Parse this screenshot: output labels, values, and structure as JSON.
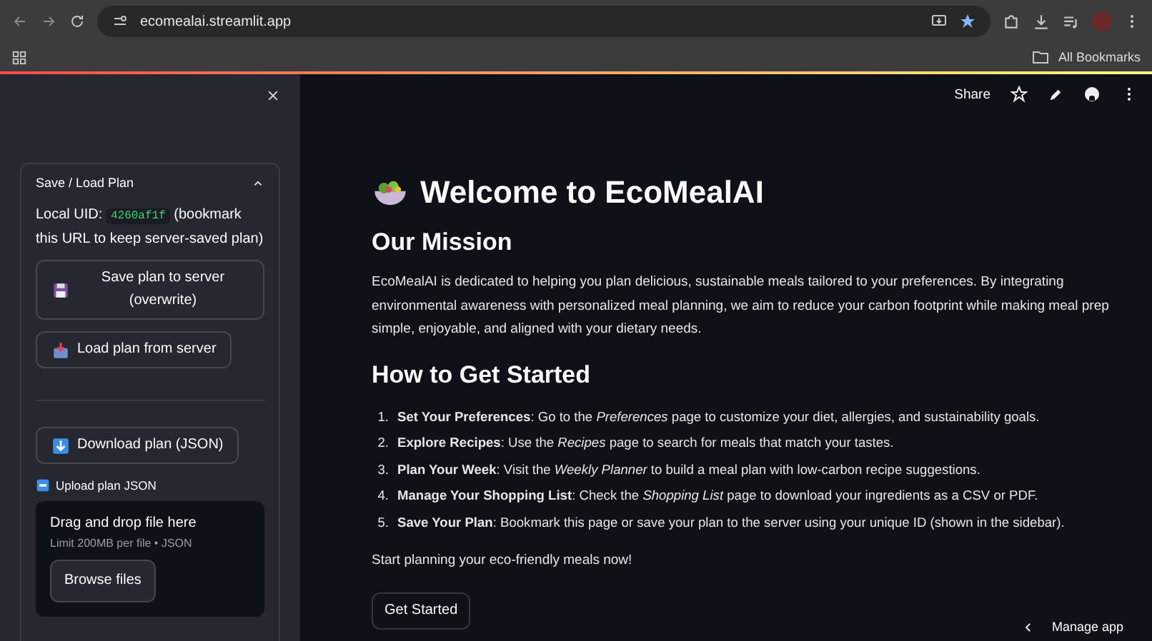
{
  "browser": {
    "url": "ecomealai.streamlit.app",
    "bookmarks_label": "All Bookmarks"
  },
  "sidebar": {
    "panel": {
      "title": "Save / Load Plan",
      "expanded": true,
      "uid_label": "Local UID:",
      "uid": "4260af1f",
      "uid_note": "(bookmark this URL to keep server-saved plan)",
      "buttons": [
        {
          "kind": "save",
          "label": "Save plan to server (overwrite)"
        },
        {
          "kind": "load",
          "label": "Load plan from server"
        }
      ],
      "download_button": {
        "kind": "download",
        "label": "Download plan (JSON)"
      },
      "upload": {
        "label": "Upload plan JSON",
        "drop_text": "Drag and drop file here",
        "limit": "Limit 200MB per file • JSON",
        "browse_button": "Browse files"
      }
    }
  },
  "toolbar": {
    "share": "Share"
  },
  "main": {
    "title": "Welcome to EcoMealAI",
    "mission_heading": "Our Mission",
    "mission_text": "EcoMealAI is dedicated to helping you plan delicious, sustainable meals tailored to your preferences. By integrating environmental awareness with personalized meal planning, we aim to reduce your carbon footprint while making meal prep simple, enjoyable, and aligned with your dietary needs.",
    "steps_heading": "How to Get Started",
    "steps": [
      {
        "number": "1.",
        "text": "**Set Your Preferences**: Go to the *Preferences* page to customize your diet, allergies, and sustainability goals."
      },
      {
        "number": "2.",
        "text": "**Explore Recipes**: Use the *Recipes* page to search for meals that match your tastes."
      },
      {
        "number": "3.",
        "text": "**Plan Your Week**: Visit the *Weekly Planner* to build a meal plan with low-carbon recipe suggestions."
      },
      {
        "number": "4.",
        "text": "**Manage Your Shopping List**: Check the *Shopping List* page to download your ingredients as a CSV or PDF."
      },
      {
        "number": "5.",
        "text": "**Save Your Plan**: Bookmark this page or save your plan to the server using your unique ID (shown in the sidebar)."
      }
    ],
    "closing": "Start planning your eco-friendly meals now!",
    "cta_button": "Get Started"
  },
  "manage_app": "Manage app"
}
